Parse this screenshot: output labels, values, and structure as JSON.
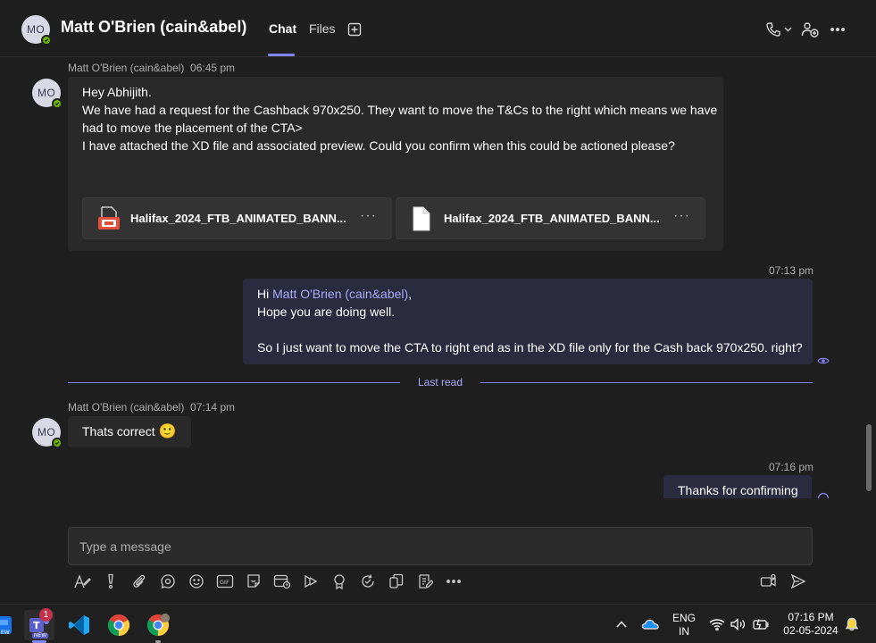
{
  "header": {
    "avatar_initials": "MO",
    "title": "Matt O'Brien (cain&abel)",
    "tabs": [
      {
        "label": "Chat",
        "active": true
      },
      {
        "label": "Files",
        "active": false
      }
    ],
    "icons": [
      "add-tab-icon",
      "call-icon",
      "chevron-down-icon",
      "add-people-icon",
      "more-icon"
    ]
  },
  "messages": [
    {
      "sender": "Matt O'Brien (cain&abel)",
      "time": "06:45 pm",
      "lines": [
        "Hey Abhijith.",
        "We have had a request for the Cashback 970x250. They want to move the T&Cs to the right which means we have",
        "had to move the placement of the CTA>",
        "I have attached the XD file and associated preview. Could you confirm when this could be actioned please?"
      ],
      "attachments": [
        {
          "name": "Halifax_2024_FTB_ANIMATED_BANN...",
          "icon": "xd-file-icon"
        },
        {
          "name": "Halifax_2024_FTB_ANIMATED_BANN...",
          "icon": "generic-file-icon"
        }
      ]
    },
    {
      "time": "07:13 pm",
      "greeting": "Hi ",
      "mention": "Matt O'Brien (cain&abel)",
      "after_mention": ",",
      "lines": [
        "Hope you are doing well.",
        "So I just want to move the CTA to right end as in the XD file only for the Cash back 970x250. right?"
      ]
    },
    {
      "sender": "Matt O'Brien (cain&abel)",
      "time": "07:14 pm",
      "text": "Thats correct",
      "emoji": "🙂"
    },
    {
      "time": "07:16 pm",
      "text": "Thanks for confirming"
    }
  ],
  "divider": {
    "label": "Last read"
  },
  "compose": {
    "placeholder": "Type a message"
  },
  "toolbar": [
    "format-icon",
    "important-icon",
    "attach-icon",
    "loop-icon",
    "emoji-icon",
    "gif-icon",
    "sticker-icon",
    "schedule-meeting-icon",
    "stream-icon",
    "praise-icon",
    "approvals-icon",
    "apps-icon",
    "updates-icon",
    "more-icon",
    "video-clip-icon",
    "send-icon"
  ],
  "taskbar": {
    "teams_badge": "1",
    "teams_label": "NEW",
    "language": [
      "ENG",
      "IN"
    ],
    "time": "07:16 PM",
    "date": "02-05-2024"
  },
  "colors": {
    "accent": "#7f85f5",
    "mention": "#a9abf8",
    "presence": "#6bb700",
    "outgoing_bubble": "#2b2b40",
    "incoming_bubble": "#292929"
  }
}
